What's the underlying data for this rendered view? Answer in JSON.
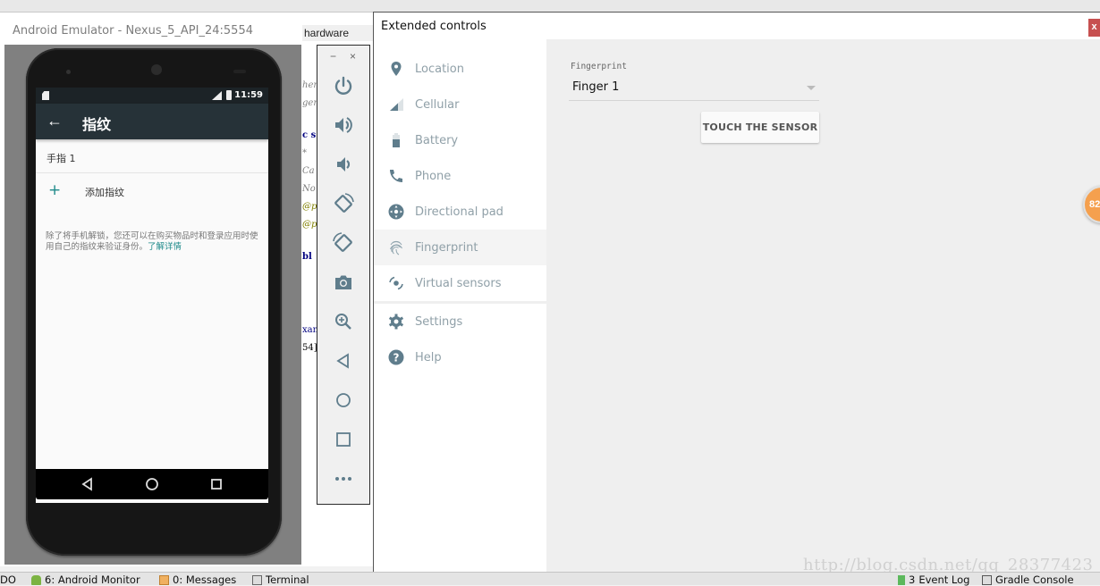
{
  "ide": {
    "breadcrumb": "hardware",
    "statusbar": {
      "todo": "DO",
      "android_monitor": "6: Android Monitor",
      "messages": "0: Messages",
      "terminal": "Terminal",
      "event_log": "Event Log",
      "event_log_count": "3",
      "gradle_console": "Gradle Console"
    }
  },
  "emulator": {
    "window_title": "Android Emulator - Nexus_5_API_24:5554",
    "phone": {
      "time": "11:59",
      "appbar_title": "指纹",
      "finger_item": "手指 1",
      "add_fingerprint": "添加指纹",
      "info_text": "除了将手机解锁，您还可以在购买物品时和登录应用时使用自己的指纹来验证身份。",
      "info_link": "了解详情"
    },
    "toolbar": {
      "minimize": "−",
      "close": "×",
      "buttons": [
        {
          "icon": "power-icon"
        },
        {
          "icon": "volume-up-icon"
        },
        {
          "icon": "volume-down-icon"
        },
        {
          "icon": "rotate-left-icon"
        },
        {
          "icon": "rotate-right-icon"
        },
        {
          "icon": "camera-icon"
        },
        {
          "icon": "zoom-icon"
        },
        {
          "icon": "back-icon"
        },
        {
          "icon": "home-icon"
        },
        {
          "icon": "overview-icon"
        },
        {
          "icon": "more-icon"
        }
      ]
    }
  },
  "extended_controls": {
    "title": "Extended controls",
    "close_label": "x",
    "nav": [
      {
        "label": "Location",
        "icon": "location-icon"
      },
      {
        "label": "Cellular",
        "icon": "cellular-icon"
      },
      {
        "label": "Battery",
        "icon": "battery-icon"
      },
      {
        "label": "Phone",
        "icon": "phone-icon"
      },
      {
        "label": "Directional pad",
        "icon": "dpad-icon"
      },
      {
        "label": "Fingerprint",
        "icon": "fingerprint-icon",
        "active": true
      },
      {
        "label": "Virtual sensors",
        "icon": "sensors-icon"
      },
      {
        "label": "Settings",
        "icon": "settings-icon"
      },
      {
        "label": "Help",
        "icon": "help-icon"
      }
    ],
    "fingerprint": {
      "label": "Fingerprint",
      "selected": "Finger 1",
      "touch_button": "TOUCH THE SENSOR"
    }
  },
  "badge": "82",
  "watermark": "http://blog.csdn.net/qq_28377423",
  "colors": {
    "icon": "#5f7d8c",
    "nav_text": "#90a0a8",
    "appbar": "#263238",
    "accent": "#1e8a8a",
    "close": "#c75050",
    "badge": "#f5a04e"
  }
}
